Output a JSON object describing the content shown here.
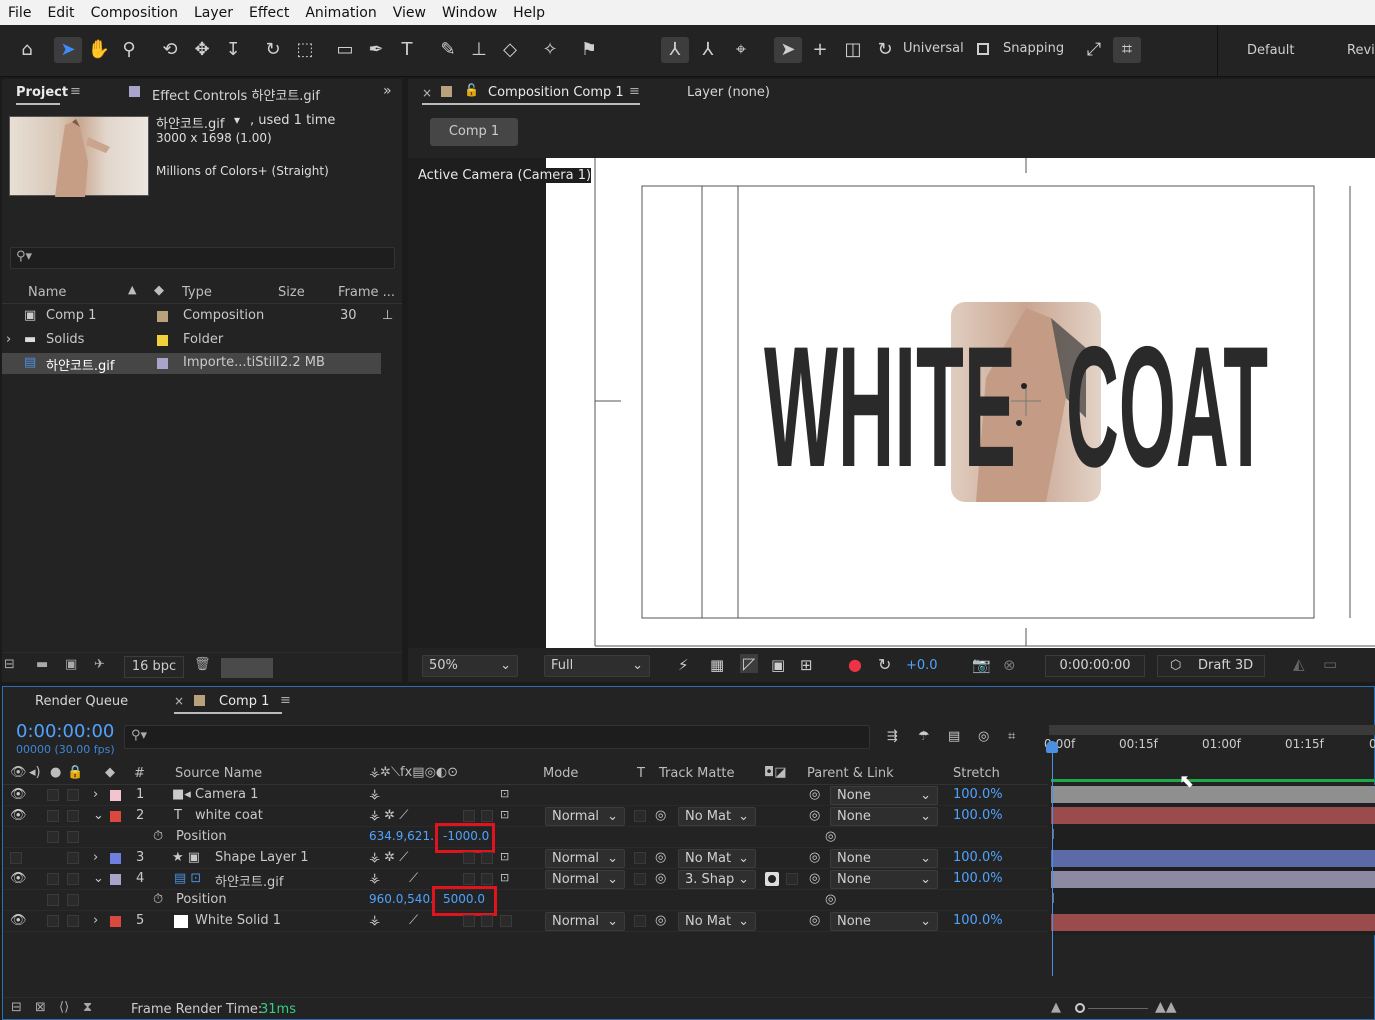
{
  "menu": [
    "File",
    "Edit",
    "Composition",
    "Layer",
    "Effect",
    "Animation",
    "View",
    "Window",
    "Help"
  ],
  "toolbar": {
    "universal": "Universal",
    "snapping": "Snapping",
    "workspace_default": "Default",
    "workspace_review": "Revi"
  },
  "project": {
    "tab_label": "Project",
    "effect_controls_label": "Effect Controls 하얀코트.gif",
    "item_name": "하얀코트.gif",
    "item_used": ", used 1 time",
    "item_dims": "3000 x 1698 (1.00)",
    "item_colors": "Millions of Colors+ (Straight)",
    "search_placeholder": "",
    "columns": {
      "name": "Name",
      "type": "Type",
      "size": "Size",
      "frame": "Frame ..."
    },
    "items": [
      {
        "name": "Comp 1",
        "type": "Composition",
        "size": "",
        "frame": "30",
        "color": "#b9a17e"
      },
      {
        "name": "Solids",
        "type": "Folder",
        "size": "",
        "frame": "",
        "color": "#f2d03b"
      },
      {
        "name": "하얀코트.gif",
        "type": "Importe...tiStill",
        "size": "2.2 MB",
        "frame": "",
        "color": "#a9a4c9"
      }
    ],
    "bpc": "16 bpc"
  },
  "comp": {
    "tab_label": "Composition Comp 1",
    "layer_tab": "Layer (none)",
    "comp_button": "Comp 1",
    "camera_label": "Active Camera (Camera 1)",
    "artwork_text_left": "WHITE",
    "artwork_text_right": "COAT",
    "zoom": "50%",
    "resolution": "Full",
    "exposure": "+0.0",
    "timecode": "0:00:00:00",
    "renderer": "Draft 3D"
  },
  "timeline": {
    "render_queue": "Render Queue",
    "comp_tab": "Comp 1",
    "timecode": "0:00:00:00",
    "frames": "00000 (30.00 fps)",
    "ruler": [
      "0:00f",
      "00:15f",
      "01:00f",
      "01:15f",
      "0"
    ],
    "columns": {
      "num": "#",
      "source": "Source Name",
      "mode": "Mode",
      "t": "T",
      "track": "Track Matte",
      "parent": "Parent & Link",
      "stretch": "Stretch"
    },
    "layers": [
      {
        "num": "1",
        "name": "Camera 1",
        "color": "#f3c3d0",
        "mode": "",
        "track": "",
        "parent": "None",
        "stretch": "100.0%",
        "bar": "#8f8f8f"
      },
      {
        "num": "2",
        "name": "white coat",
        "color": "#d9493f",
        "mode": "Normal",
        "track": "No Mat",
        "parent": "None",
        "stretch": "100.0%",
        "bar": "#9a4b4b"
      },
      {
        "num": "3",
        "name": "Shape Layer 1",
        "color": "#6e7fe0",
        "mode": "Normal",
        "track": "No Mat",
        "parent": "None",
        "stretch": "100.0%",
        "bar": "#5d6aa8"
      },
      {
        "num": "4",
        "name": "하얀코트.gif",
        "color": "#a9a4c9",
        "mode": "Normal",
        "track": "3. Shap",
        "parent": "None",
        "stretch": "100.0%",
        "bar": "#8c8aa3"
      },
      {
        "num": "5",
        "name": "White Solid 1",
        "color": "#d9493f",
        "mode": "Normal",
        "track": "No Mat",
        "parent": "None",
        "stretch": "100.0%",
        "bar": "#9a4b4b"
      }
    ],
    "position_label": "Position",
    "pos2": {
      "xy": "634.9,621.",
      "z": "-1000.0"
    },
    "pos4": {
      "xy": "960.0,540.",
      "z": "5000.0"
    },
    "frame_render_label": "Frame Render Time:",
    "frame_render_value": "31ms"
  }
}
